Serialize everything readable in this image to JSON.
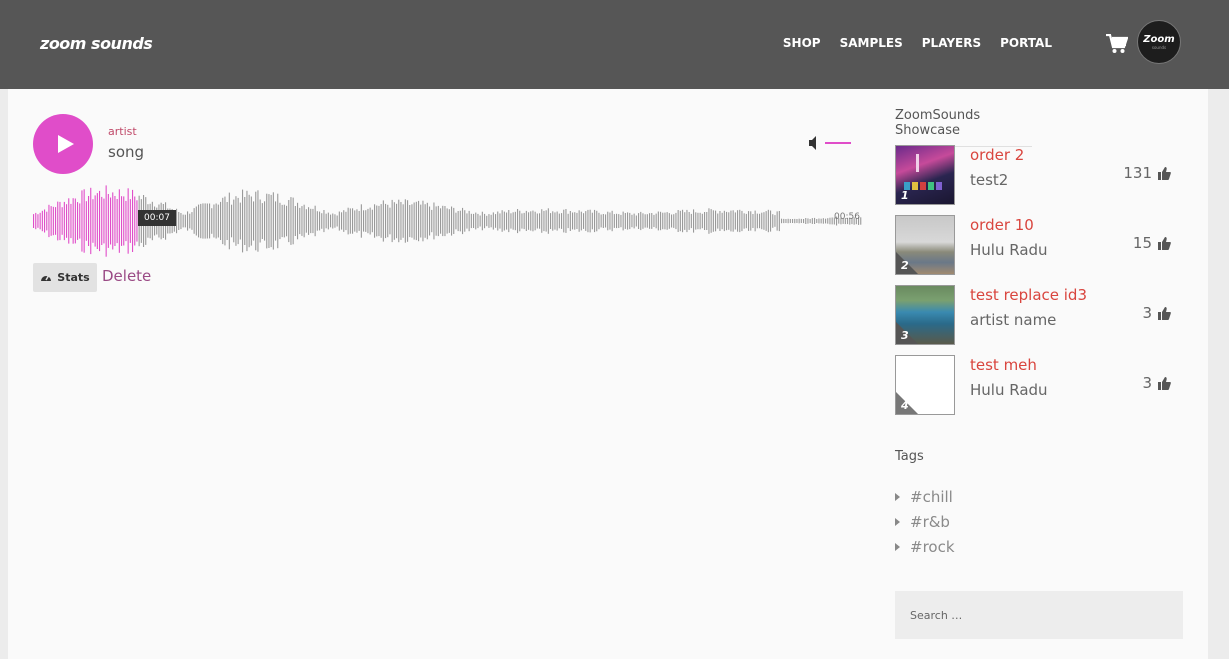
{
  "header": {
    "logo_text": "zoom sounds",
    "nav": [
      "SHOP",
      "SAMPLES",
      "PLAYERS",
      "PORTAL"
    ],
    "avatar_text": "Zoom",
    "avatar_sub": "sounds"
  },
  "player": {
    "artist": "artist",
    "song": "song",
    "time_current": "00:07",
    "time_total": "00:56",
    "progress": 0.125,
    "stats_label": "Stats",
    "delete_label": "Delete",
    "accent_color": "#e04dc9"
  },
  "sidebar": {
    "showcase_title": "ZoomSounds Showcase",
    "items": [
      {
        "rank": "1",
        "title": "order 2",
        "artist": "test2",
        "likes": "131"
      },
      {
        "rank": "2",
        "title": "order 10",
        "artist": "Hulu Radu",
        "likes": "15"
      },
      {
        "rank": "3",
        "title": "test replace id3",
        "artist": "artist name",
        "likes": "3"
      },
      {
        "rank": "4",
        "title": "test meh",
        "artist": "Hulu Radu",
        "likes": "3"
      }
    ],
    "tags_title": "Tags",
    "tags": [
      "#chill",
      "#r&b",
      "#rock"
    ],
    "search_placeholder": "Search …"
  }
}
